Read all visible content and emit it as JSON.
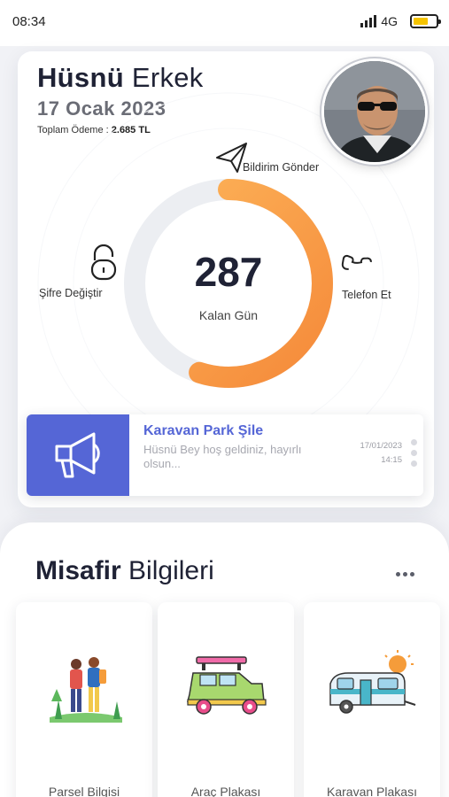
{
  "status_bar": {
    "time": "08:34",
    "network": "4G",
    "battery_level": 0.65,
    "battery_color": "#f5c400"
  },
  "profile": {
    "first_name": "Hüsnü",
    "last_name": "Erkek",
    "date": "17 Ocak 2023",
    "payment_label": "Toplam Ödeme :",
    "payment_value": "2.685 TL",
    "avatar_icon": "profile-photo"
  },
  "countdown": {
    "value": "287",
    "label": "Kalan Gün",
    "progress_fraction": 0.55,
    "track_color": "#eceef2",
    "gradient_start": "#f58a3a",
    "gradient_end": "#fdb55a"
  },
  "actions": {
    "send_notification": {
      "label": "Bildirim Gönder",
      "icon": "paper-plane-icon"
    },
    "change_password": {
      "label": "Şifre Değiştir",
      "icon": "lock-icon"
    },
    "call": {
      "label": "Telefon Et",
      "icon": "phone-icon"
    }
  },
  "notification": {
    "icon": "megaphone-icon",
    "title": "Karavan Park Şile",
    "message": "Hüsnü Bey hoş geldiniz, hayırlı olsun...",
    "date": "17/01/2023",
    "time": "14:15",
    "accent_color": "#5566d6"
  },
  "guest_section": {
    "title_bold": "Misafir",
    "title_regular": "Bilgileri",
    "tiles": [
      {
        "label": "Parsel Bilgisi",
        "icon": "hikers-icon"
      },
      {
        "label": "Araç Plakası",
        "icon": "car-icon"
      },
      {
        "label": "Karavan Plakası",
        "icon": "caravan-icon"
      }
    ]
  }
}
